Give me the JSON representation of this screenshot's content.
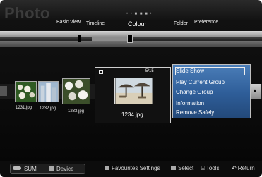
{
  "app": {
    "title": "Photo"
  },
  "view_modes": {
    "basic": "Basic View",
    "timeline": "Timeline",
    "colour": "Colour",
    "folder": "Folder",
    "preference": "Preference",
    "indicator": "• • ■ ■ ■ •"
  },
  "thumbnails": [
    {
      "name": "1231.jpg"
    },
    {
      "name": "1232.jpg"
    },
    {
      "name": "1233.jpg"
    }
  ],
  "selected": {
    "name": "1234.jpg",
    "counter": "5/15"
  },
  "context_menu": {
    "items": [
      "Slide Show",
      "Play Current Group",
      "Change Group",
      "Information",
      "Remove Safely"
    ],
    "highlighted_index": 0
  },
  "bottom_bar": {
    "sum": "SUM",
    "device": "Device",
    "favourites": "Favourites Settings",
    "select": "Select",
    "tools": "Tools",
    "return": "Return"
  },
  "colors": {
    "menu": "#2e5d98",
    "background": "#0b0b0b"
  }
}
